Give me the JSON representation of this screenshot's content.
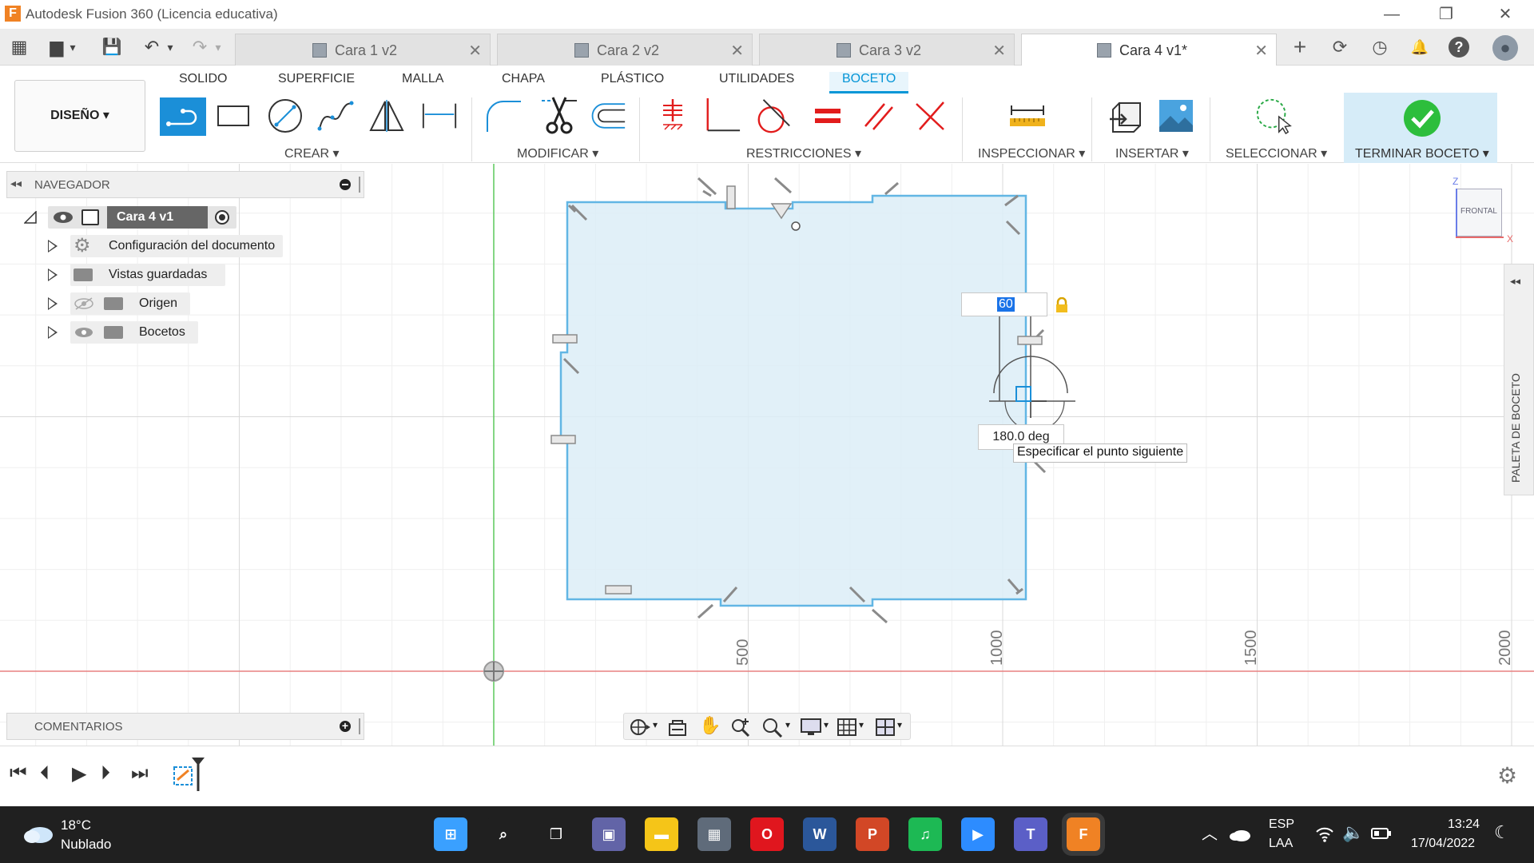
{
  "window": {
    "title": "Autodesk Fusion 360 (Licencia educativa)",
    "logo_letter": "F",
    "minimize": "—",
    "restore": "❐",
    "close": "✕"
  },
  "quick_access": {
    "grid": "▦",
    "file": "▆",
    "dropdown": "▾",
    "save": "💾",
    "undo": "↶",
    "redo": "↷"
  },
  "doc_tabs": [
    {
      "label": "Cara 1 v2",
      "close": "✕"
    },
    {
      "label": "Cara 2 v2",
      "close": "✕"
    },
    {
      "label": "Cara 3 v2",
      "close": "✕"
    },
    {
      "label": "Cara 4 v1*",
      "close": "✕"
    }
  ],
  "tab_right": {
    "plus": "+",
    "sync": "⟳",
    "clock": "◷",
    "bell": "🔔",
    "help": "?",
    "avatar": "●"
  },
  "menu_tabs": [
    "SOLIDO",
    "SUPERFICIE",
    "MALLA",
    "CHAPA",
    "PLÁSTICO",
    "UTILIDADES",
    "BOCETO"
  ],
  "workspace": {
    "label": "DISEÑO ▾"
  },
  "groups": {
    "crear": "CREAR ▾",
    "modificar": "MODIFICAR ▾",
    "restricciones": "RESTRICCIONES ▾",
    "inspeccionar": "INSPECCIONAR ▾",
    "insertar": "INSERTAR ▾",
    "seleccionar": "SELECCIONAR ▾",
    "terminar": "TERMINAR BOCETO ▾"
  },
  "navigator": {
    "header": "NAVEGADOR",
    "collapse": "◂◂",
    "root": "Cara 4 v1",
    "items": [
      {
        "label": "Configuración del documento"
      },
      {
        "label": "Vistas guardadas"
      },
      {
        "label": "Origen"
      },
      {
        "label": "Bocetos"
      }
    ]
  },
  "comments": {
    "header": "COMENTARIOS",
    "add": "+"
  },
  "sketch": {
    "dimension_value": "60",
    "angle_value": "180.0 deg",
    "tooltip": "Especificar el punto siguiente"
  },
  "axis_ticks": [
    "500",
    "1000",
    "1500",
    "2000"
  ],
  "viewcube": {
    "label": "FRONTAL",
    "z": "Z",
    "x": "X"
  },
  "palette": {
    "label": "PALETA DE BOCETO",
    "collapse": "◂◂"
  },
  "timeline": {
    "first": "⏮",
    "prev": "⏴",
    "play": "▶",
    "next": "⏵",
    "last": "⏭",
    "settings": "⚙"
  },
  "taskbar": {
    "weather_temp": "18°C",
    "weather_desc": "Nublado",
    "lang1": "ESP",
    "lang2": "LAA",
    "time": "13:24",
    "date": "17/04/2022",
    "apps": [
      {
        "name": "windows",
        "glyph": "⊞",
        "color": "#3aa0ff"
      },
      {
        "name": "search",
        "glyph": "⌕",
        "color": "#202020"
      },
      {
        "name": "task-view",
        "glyph": "❐",
        "color": "#202020"
      },
      {
        "name": "chat",
        "glyph": "▣",
        "color": "#6264a7"
      },
      {
        "name": "explorer",
        "glyph": "▬",
        "color": "#f5c518"
      },
      {
        "name": "calculator",
        "glyph": "▦",
        "color": "#5f6b7a"
      },
      {
        "name": "opera",
        "glyph": "O",
        "color": "#e0161e"
      },
      {
        "name": "word",
        "glyph": "W",
        "color": "#2b579a"
      },
      {
        "name": "powerpoint",
        "glyph": "P",
        "color": "#d24726"
      },
      {
        "name": "spotify",
        "glyph": "♫",
        "color": "#1db954"
      },
      {
        "name": "zoom",
        "glyph": "▶",
        "color": "#2d8cff"
      },
      {
        "name": "teams",
        "glyph": "T",
        "color": "#5b5fc7"
      },
      {
        "name": "fusion",
        "glyph": "F",
        "color": "#f08224"
      }
    ]
  }
}
